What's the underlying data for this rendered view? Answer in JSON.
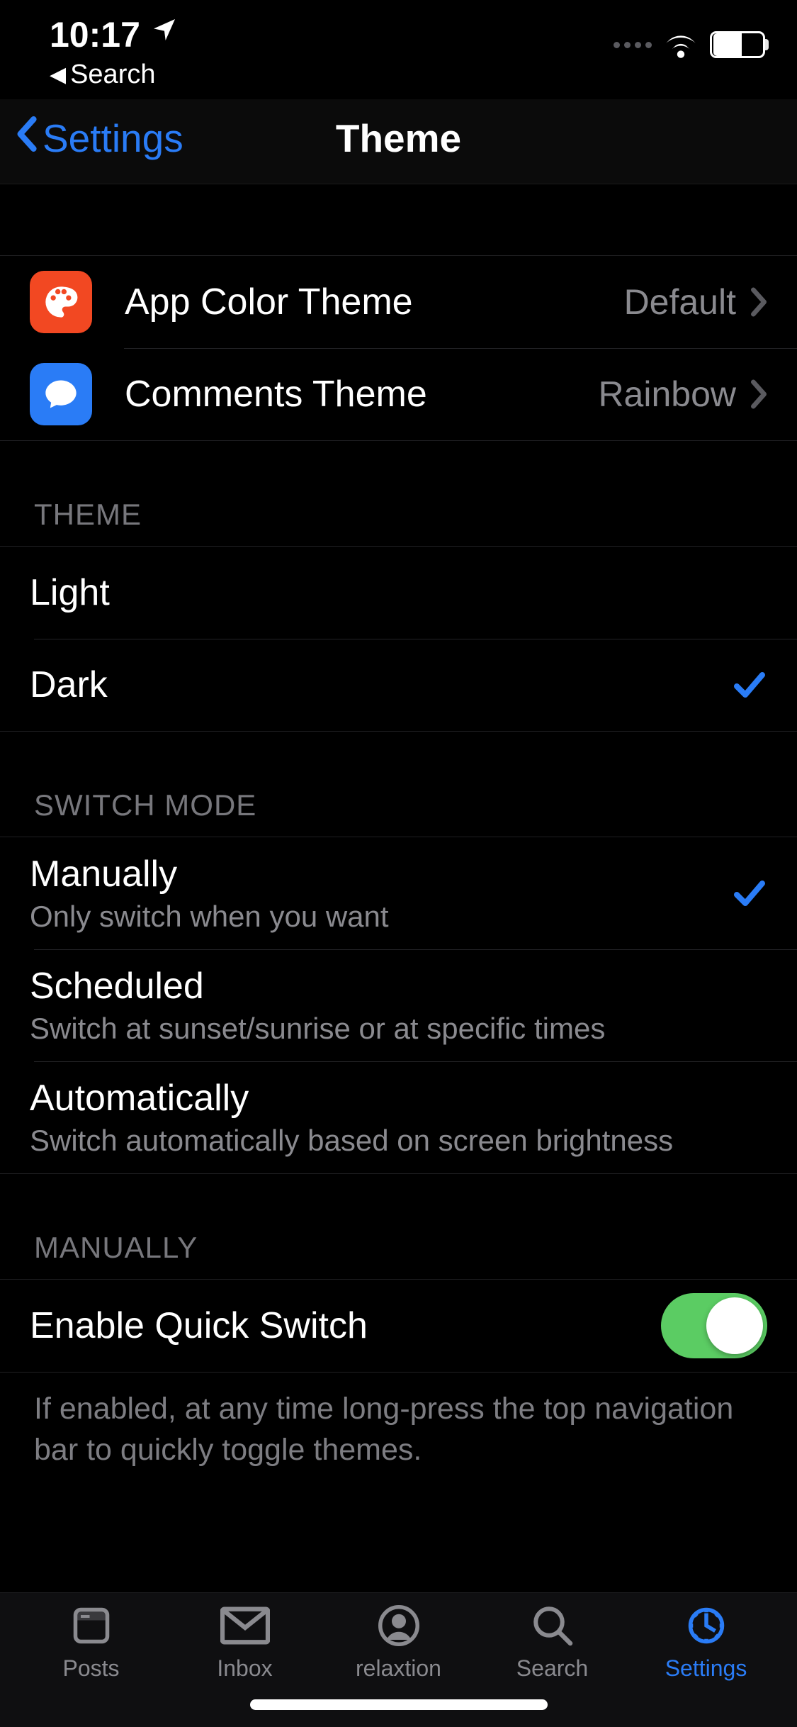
{
  "status": {
    "time": "10:17",
    "breadcrumb_app": "Search"
  },
  "nav": {
    "back_label": "Settings",
    "title": "Theme"
  },
  "theme_links": [
    {
      "icon": "palette",
      "label": "App Color Theme",
      "value": "Default"
    },
    {
      "icon": "comment",
      "label": "Comments Theme",
      "value": "Rainbow"
    }
  ],
  "sections": {
    "theme": {
      "header": "Theme",
      "options": [
        {
          "label": "Light",
          "selected": false
        },
        {
          "label": "Dark",
          "selected": true
        }
      ]
    },
    "switch_mode": {
      "header": "Switch Mode",
      "options": [
        {
          "label": "Manually",
          "sub": "Only switch when you want",
          "selected": true
        },
        {
          "label": "Scheduled",
          "sub": "Switch at sunset/sunrise or at specific times",
          "selected": false
        },
        {
          "label": "Automatically",
          "sub": "Switch automatically based on screen brightness",
          "selected": false
        }
      ]
    },
    "manually": {
      "header": "Manually",
      "toggle_label": "Enable Quick Switch",
      "toggle_on": true,
      "footer": "If enabled, at any time long-press the top navigation bar to quickly toggle themes."
    }
  },
  "tabs": [
    {
      "id": "posts",
      "label": "Posts"
    },
    {
      "id": "inbox",
      "label": "Inbox"
    },
    {
      "id": "profile",
      "label": "relaxtion"
    },
    {
      "id": "search",
      "label": "Search"
    },
    {
      "id": "settings",
      "label": "Settings",
      "active": true
    }
  ]
}
